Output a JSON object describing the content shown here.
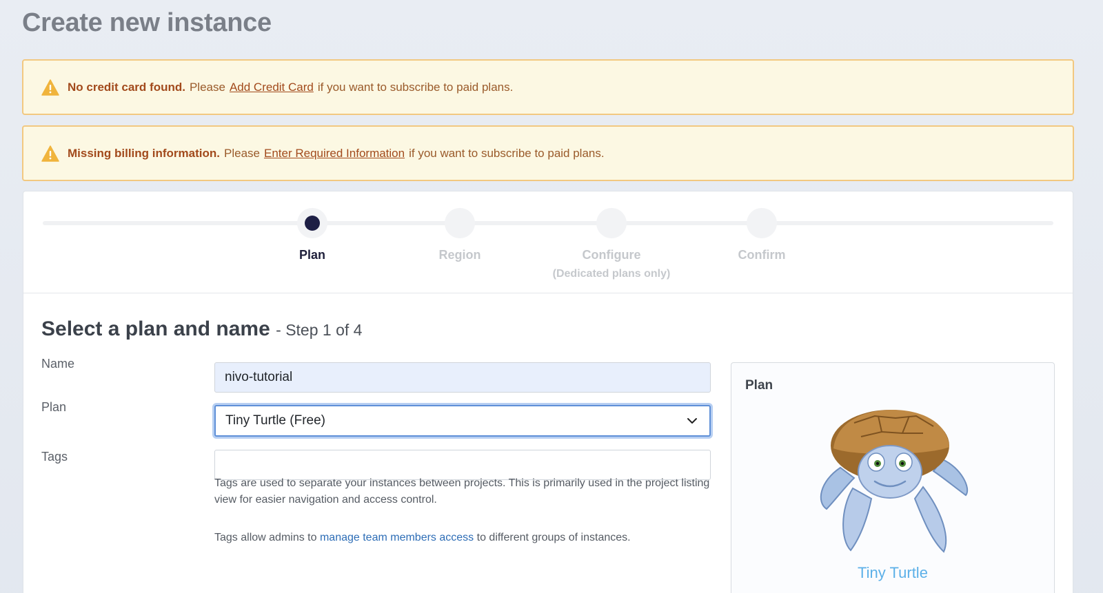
{
  "page": {
    "title": "Create new instance"
  },
  "alerts": [
    {
      "bold": "No credit card found.",
      "pre": "Please",
      "link": "Add Credit Card",
      "post": "if you want to subscribe to paid plans."
    },
    {
      "bold": "Missing billing information.",
      "pre": "Please",
      "link": "Enter Required Information",
      "post": "if you want to subscribe to paid plans."
    }
  ],
  "stepper": {
    "steps": [
      {
        "label": "Plan",
        "sub": "",
        "active": true
      },
      {
        "label": "Region",
        "sub": "",
        "active": false
      },
      {
        "label": "Configure",
        "sub": "(Dedicated plans only)",
        "active": false
      },
      {
        "label": "Confirm",
        "sub": "",
        "active": false
      }
    ]
  },
  "form": {
    "title": "Select a plan and name",
    "step_text": "- Step 1 of 4",
    "name_label": "Name",
    "name_value": "nivo-tutorial",
    "plan_label": "Plan",
    "plan_value": "Tiny Turtle (Free)",
    "tags_label": "Tags",
    "tags_value": "",
    "tags_help": "Tags are used to separate your instances between projects. This is primarily used in the project listing view for easier navigation and access control.",
    "tags_admin_pre": "Tags allow admins to",
    "tags_admin_link": "manage team members access",
    "tags_admin_post": "to different groups of instances."
  },
  "plan_panel": {
    "title": "Plan",
    "plan_name": "Tiny Turtle",
    "image": "turtle-mascot"
  },
  "colors": {
    "alert_bg": "#fcf8e3",
    "alert_border": "#f2c880",
    "active_step": "#1e1f45",
    "link_blue": "#2d6db6",
    "plan_name": "#5cb0e8"
  }
}
